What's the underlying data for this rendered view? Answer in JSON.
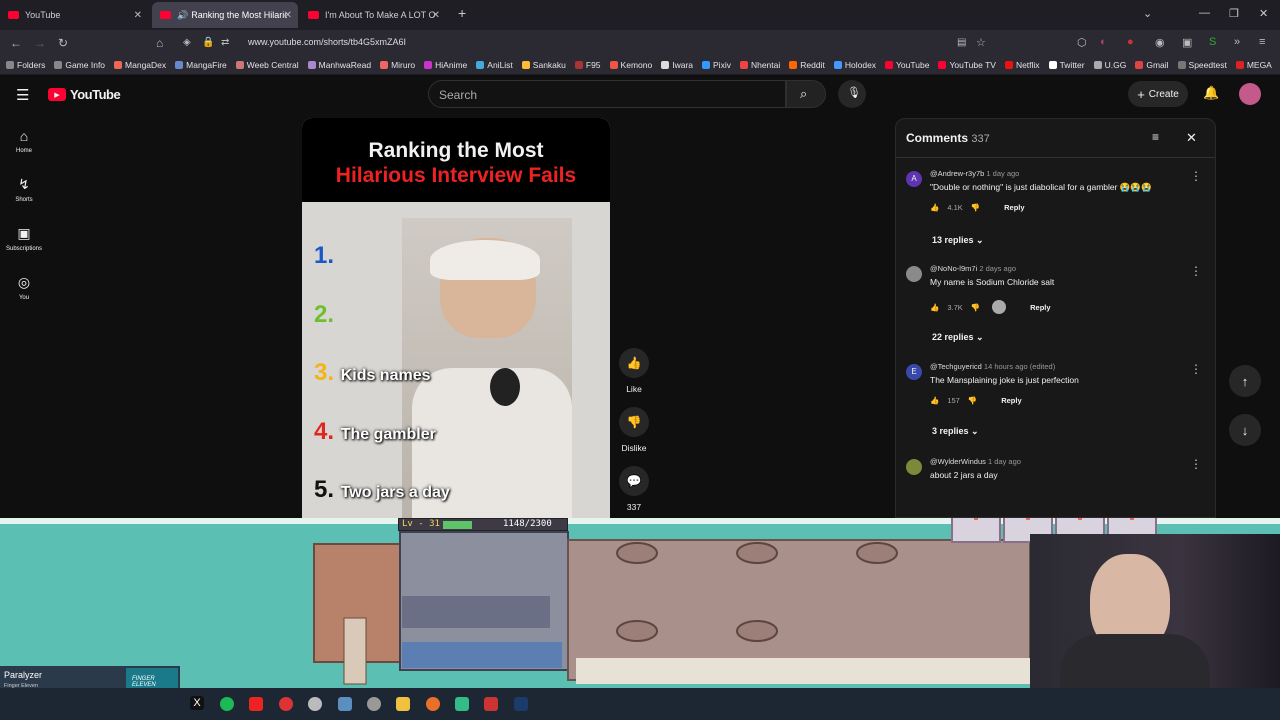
{
  "browser": {
    "tabs": [
      {
        "label": "YouTube",
        "active": false
      },
      {
        "label": "Ranking the Most Hilarious",
        "active": true
      },
      {
        "label": "I'm About To Make A LOT Of Pe",
        "active": false
      }
    ],
    "url": "www.youtube.com/shorts/tb4G5xmZA6I",
    "bookmarks": [
      "Folders",
      "Game Info",
      "MangaDex",
      "MangaFire",
      "Weeb Central",
      "ManhwaRead",
      "Miruro",
      "HiAnime",
      "AniList",
      "Sankaku",
      "F95",
      "Kemono",
      "Iwara",
      "Pixiv",
      "Nhentai",
      "Reddit",
      "Holodex",
      "YouTube",
      "YouTube TV",
      "Netflix",
      "Twitter",
      "U.GG",
      "Gmail",
      "Speedtest",
      "MEGA"
    ]
  },
  "youtube": {
    "logo": "YouTube",
    "search_placeholder": "Search",
    "create_label": "Create",
    "sidebar": [
      {
        "label": "Home",
        "icon": "home-icon"
      },
      {
        "label": "Shorts",
        "icon": "shorts-icon"
      },
      {
        "label": "Subscriptions",
        "icon": "subscriptions-icon"
      },
      {
        "label": "You",
        "icon": "you-icon"
      }
    ]
  },
  "short": {
    "title_line1": "Ranking the Most",
    "title_line2": "Hilarious Interview Fails",
    "ranks": [
      {
        "num": "1.",
        "text": "",
        "color": "#1a57c9"
      },
      {
        "num": "2.",
        "text": "",
        "color": "#6fbf2c"
      },
      {
        "num": "3.",
        "text": "Kids names",
        "color": "#f2b418"
      },
      {
        "num": "4.",
        "text": "The gambler",
        "color": "#e0271d"
      },
      {
        "num": "5.",
        "text": "Two jars a day",
        "color": "#111111"
      }
    ],
    "actions": {
      "like": "Like",
      "dislike": "Dislike",
      "comments_count": "337"
    }
  },
  "comments": {
    "title": "Comments",
    "count": "337",
    "items": [
      {
        "author": "@Andrew-r3y7b",
        "time": "1 day ago",
        "text": "\"Double or nothing\" is just diabolical for a gambler 😭😭😭",
        "likes": "4.1K",
        "reply": "Reply",
        "replies": "13 replies",
        "avatar": "A",
        "avatar_color": "#5e35b1"
      },
      {
        "author": "@NoNo-l9m7i",
        "time": "2 days ago",
        "text": "My name is Sodium Chloride salt",
        "likes": "3.7K",
        "reply": "Reply",
        "replies": "22 replies",
        "avatar": "",
        "avatar_color": "#8a8a8a"
      },
      {
        "author": "@Techguyericd",
        "time": "14 hours ago (edited)",
        "text": "The Mansplaining joke is just perfection",
        "likes": "157",
        "reply": "Reply",
        "replies": "3 replies",
        "avatar": "E",
        "avatar_color": "#3949ab"
      },
      {
        "author": "@WylderWindus",
        "time": "1 day ago",
        "text": "about 2 jars a day",
        "likes": "",
        "reply": "",
        "replies": "",
        "avatar": "",
        "avatar_color": "#7a8a3a"
      }
    ]
  },
  "game": {
    "level": "Lv - 31",
    "xp": "1148/2300",
    "xp_fraction": 0.5
  },
  "taskbar": {
    "media_title": "Paralyzer",
    "media_artist": "Finger Eleven",
    "album_text": "FINGER ELEVEN"
  }
}
